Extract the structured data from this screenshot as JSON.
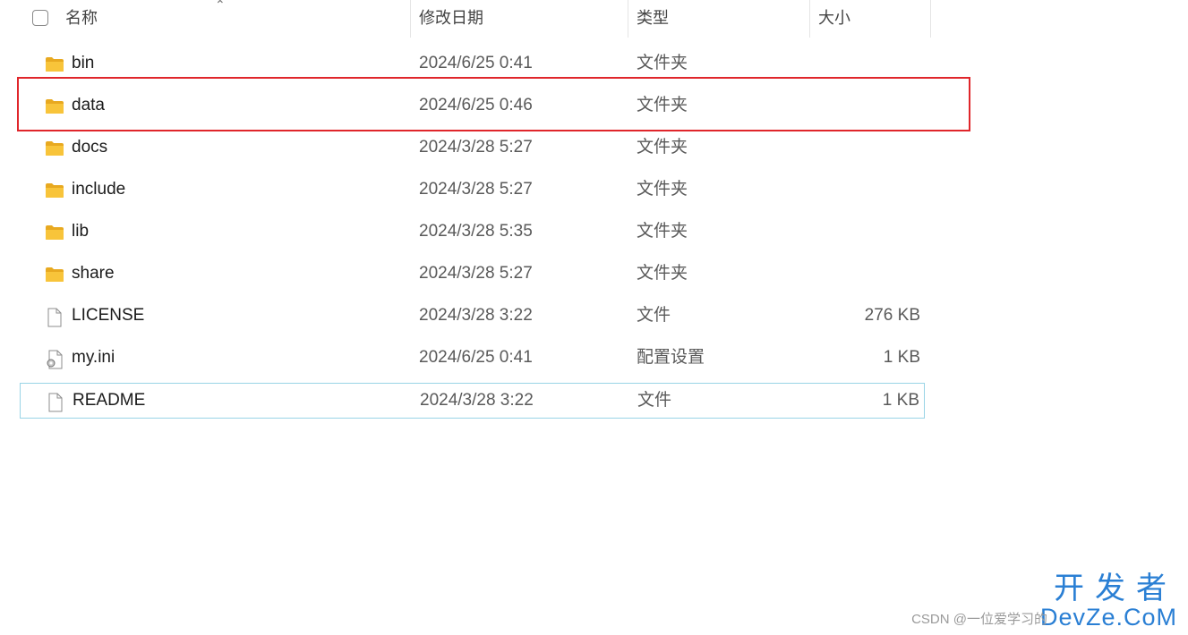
{
  "columns": {
    "name": "名称",
    "date": "修改日期",
    "type": "类型",
    "size": "大小"
  },
  "sort": {
    "column": "name",
    "icon": "chevron-up-icon"
  },
  "files": [
    {
      "name": "bin",
      "date": "2024/6/25 0:41",
      "type": "文件夹",
      "size": "",
      "icon": "folder-icon"
    },
    {
      "name": "data",
      "date": "2024/6/25 0:46",
      "type": "文件夹",
      "size": "",
      "icon": "folder-icon",
      "highlighted": true
    },
    {
      "name": "docs",
      "date": "2024/3/28 5:27",
      "type": "文件夹",
      "size": "",
      "icon": "folder-icon"
    },
    {
      "name": "include",
      "date": "2024/3/28 5:27",
      "type": "文件夹",
      "size": "",
      "icon": "folder-icon"
    },
    {
      "name": "lib",
      "date": "2024/3/28 5:35",
      "type": "文件夹",
      "size": "",
      "icon": "folder-icon"
    },
    {
      "name": "share",
      "date": "2024/3/28 5:27",
      "type": "文件夹",
      "size": "",
      "icon": "folder-icon"
    },
    {
      "name": "LICENSE",
      "date": "2024/3/28 3:22",
      "type": "文件",
      "size": "276 KB",
      "icon": "file-icon"
    },
    {
      "name": "my.ini",
      "date": "2024/6/25 0:41",
      "type": "配置设置",
      "size": "1 KB",
      "icon": "config-file-icon"
    },
    {
      "name": "README",
      "date": "2024/3/28 3:22",
      "type": "文件",
      "size": "1 KB",
      "icon": "file-icon",
      "focused": true
    }
  ],
  "colors": {
    "folder": "#f8c43a",
    "annotation": "#e0262b",
    "focus": "#99d4e6",
    "watermark": "#2a7fd4"
  },
  "watermark": {
    "big": "开发者",
    "small": "CSDN @一位爱学习的",
    "domain": "DevZe.CoM"
  }
}
